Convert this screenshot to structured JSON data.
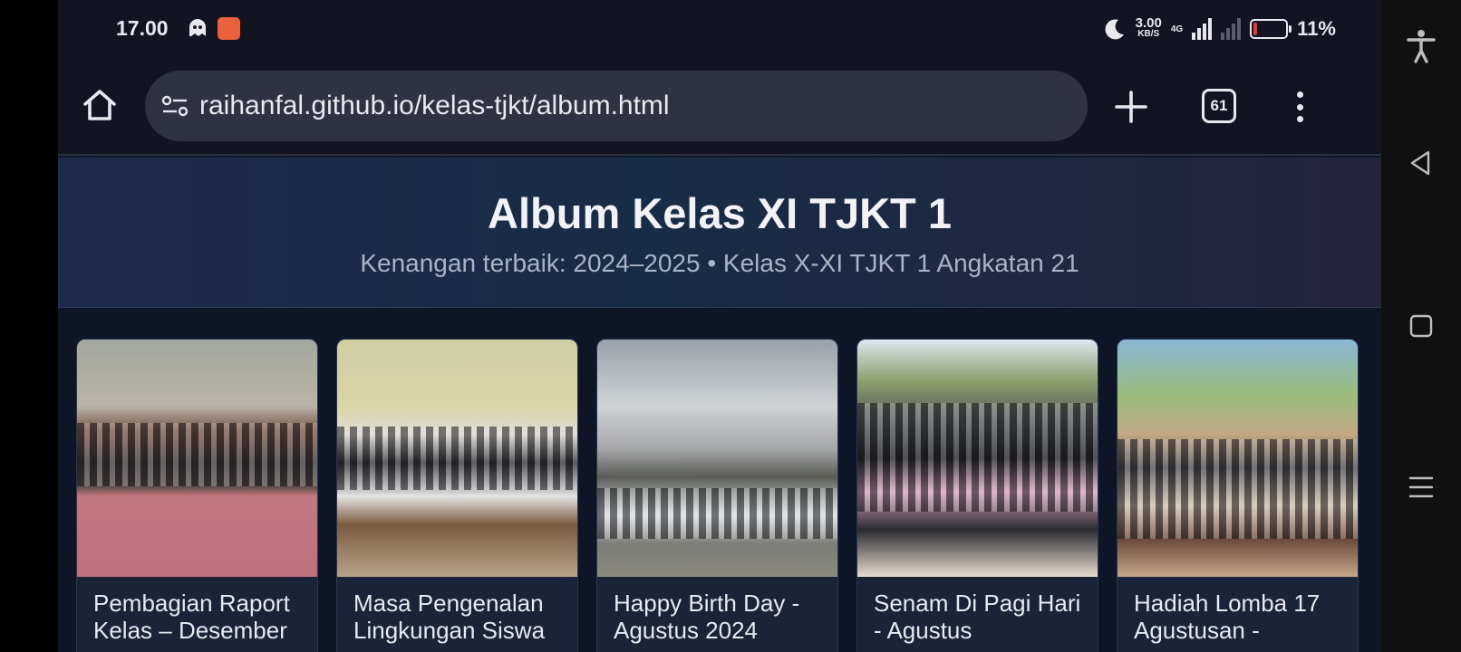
{
  "status_bar": {
    "time": "17.00",
    "speed_value": "3.00",
    "speed_unit": "KB/S",
    "network_type": "4G",
    "battery_percent": "11%",
    "battery_level": 0.11,
    "battery_color": "#e53935",
    "icons": [
      "ghost-icon",
      "game-app-icon",
      "moon-icon",
      "signal-icon",
      "no-signal-icon",
      "battery-icon"
    ]
  },
  "browser": {
    "url": "raihanfal.github.io/kelas-tjkt/album.html",
    "tab_count": "61",
    "icons": [
      "home-icon",
      "site-settings-icon",
      "plus-icon",
      "tabs-icon",
      "overflow-menu-icon"
    ]
  },
  "page": {
    "title": "Album Kelas XI TJKT 1",
    "subtitle": "Kenangan terbaik: 2024–2025 • Kelas X-XI TJKT 1 Angkatan 21",
    "albums": [
      {
        "title": "Pembagian Raport Kelas – Desember"
      },
      {
        "title": "Masa Pengenalan Lingkungan Siswa"
      },
      {
        "title": "Happy Birth Day - Agustus 2024"
      },
      {
        "title": "Senam Di Pagi Hari - Agustus"
      },
      {
        "title": "Hadiah Lomba 17 Agustusan -"
      }
    ]
  },
  "system_nav": {
    "icons": [
      "accessibility-icon",
      "back-icon",
      "recents-icon",
      "menu-icon"
    ]
  }
}
